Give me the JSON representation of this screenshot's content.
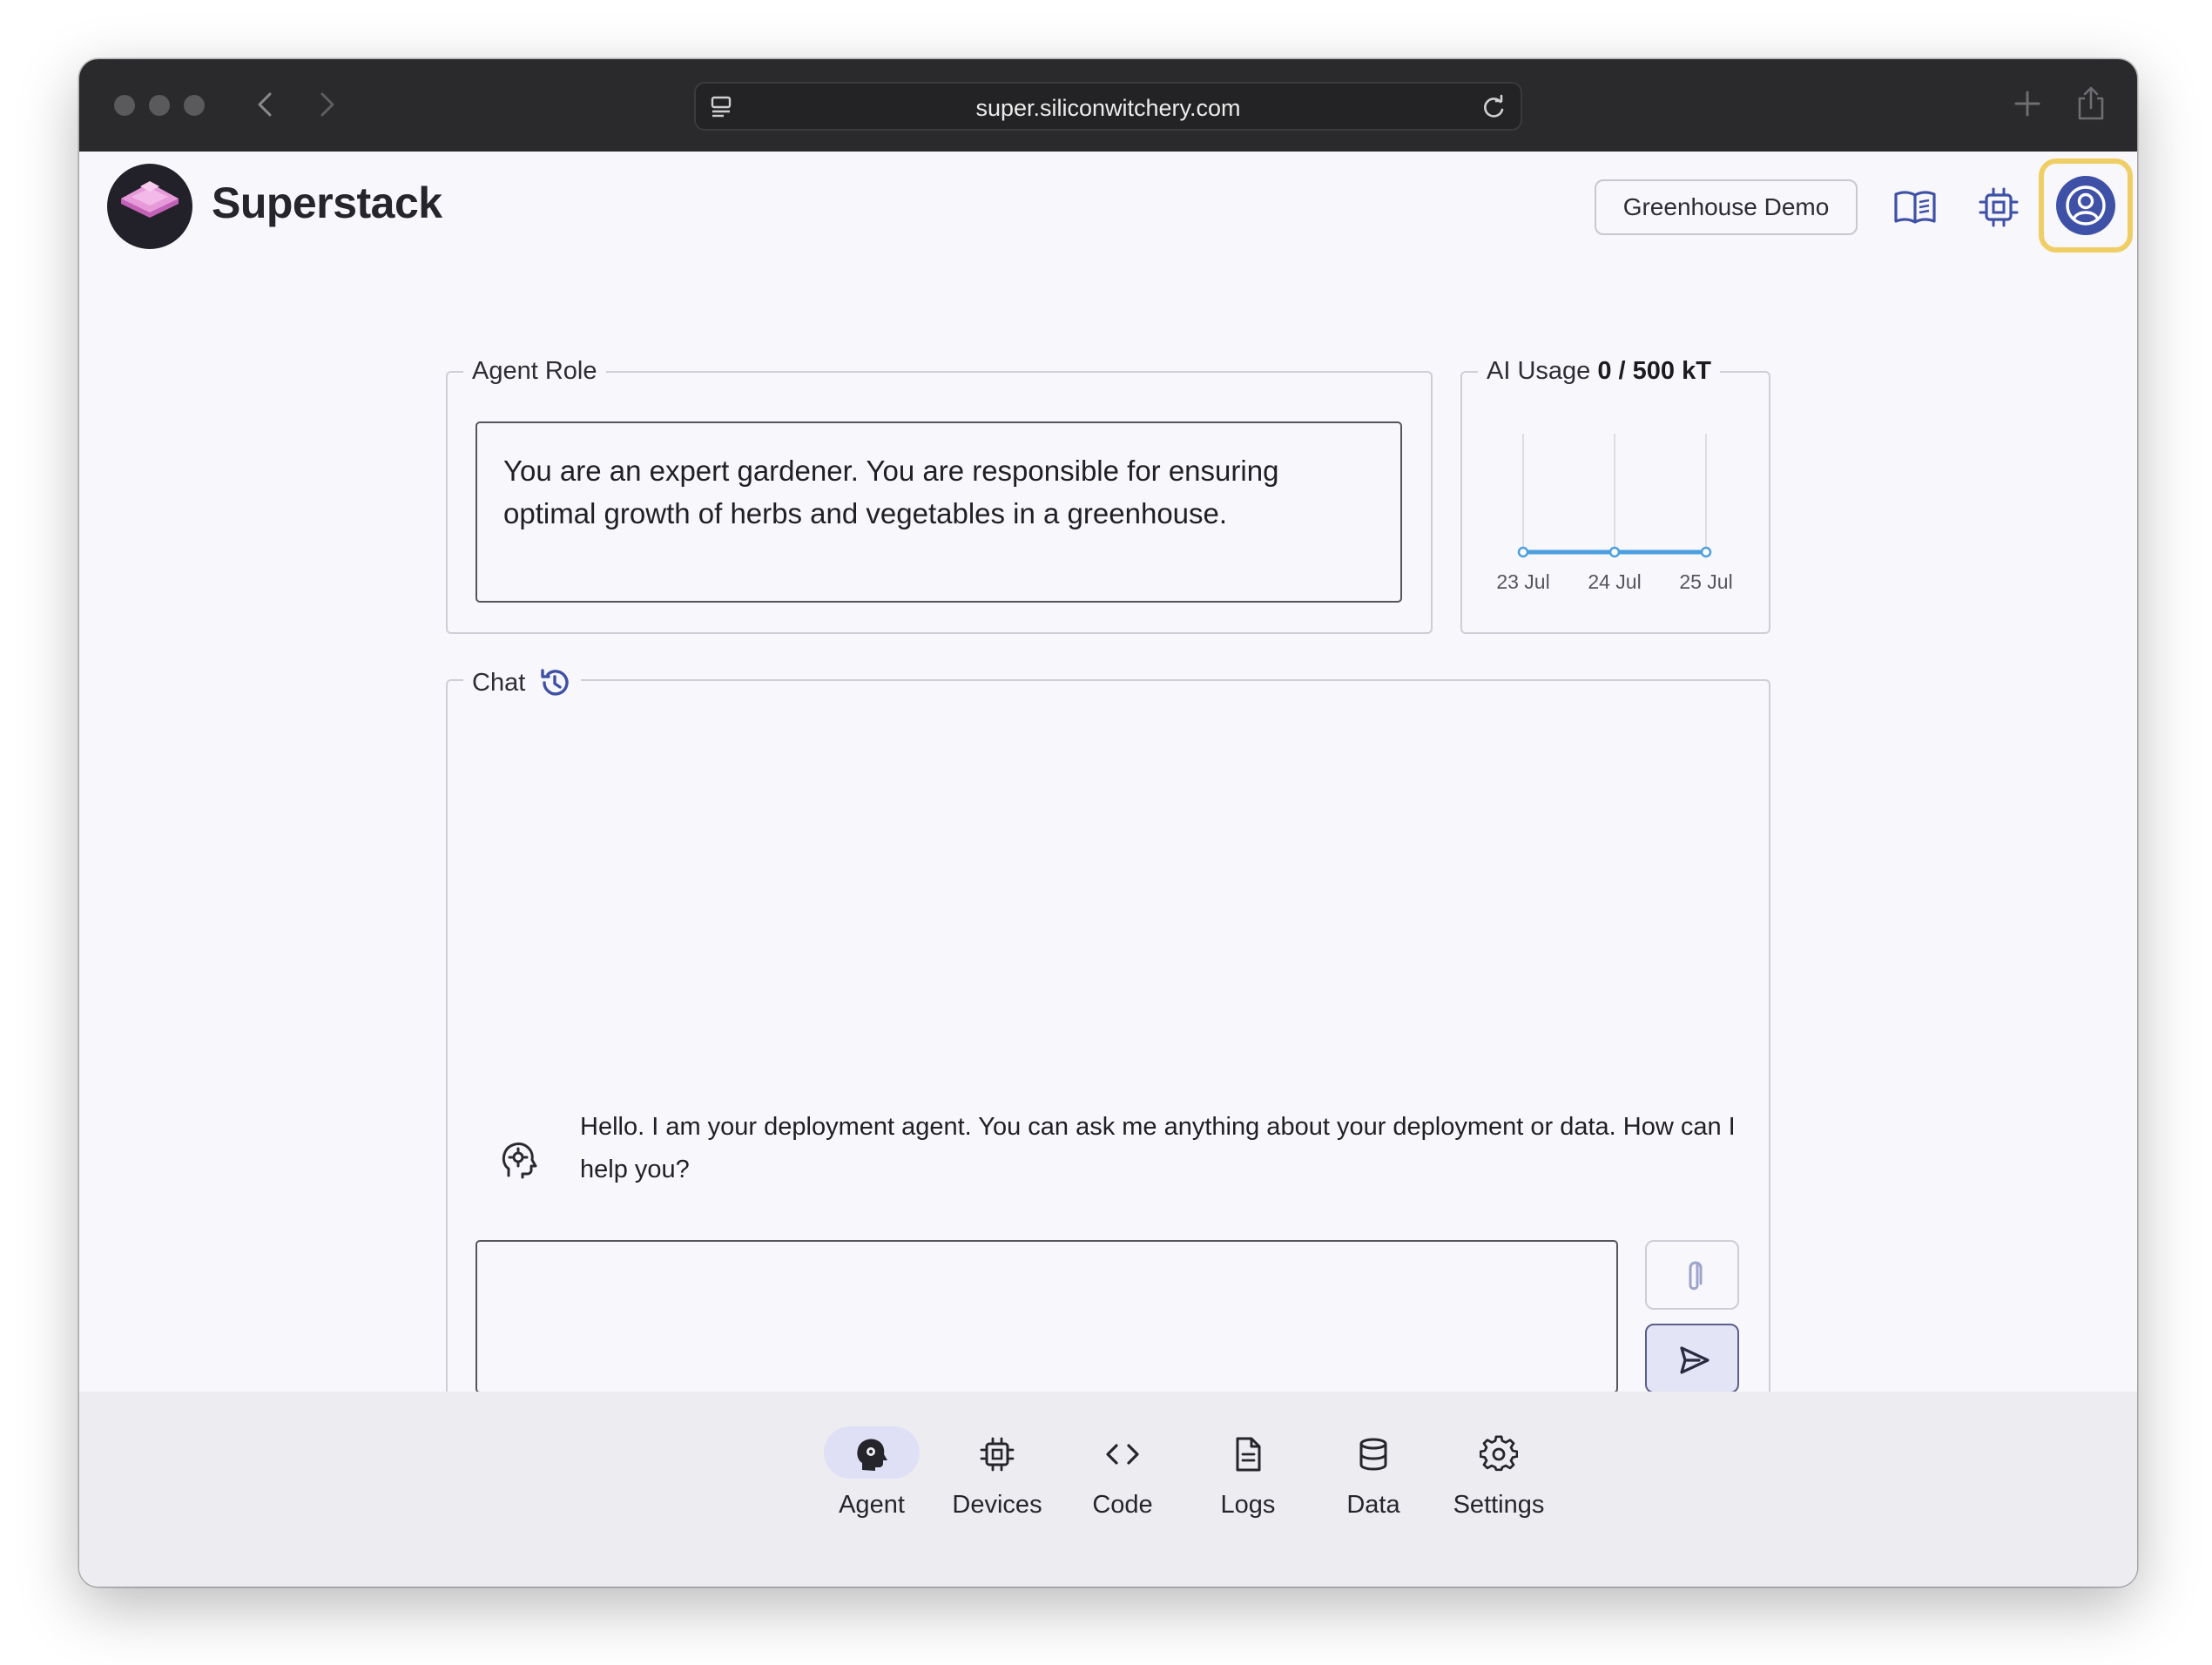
{
  "browser": {
    "url": "super.siliconwitchery.com"
  },
  "header": {
    "brand": "Superstack",
    "project_button": "Greenhouse Demo",
    "icons": [
      "docs-book-icon",
      "device-chip-icon",
      "account-circle-icon"
    ]
  },
  "agent_role": {
    "legend": "Agent Role",
    "text": "You are an expert gardener. You are responsible for ensuring optimal growth of herbs and vegetables in a greenhouse."
  },
  "ai_usage": {
    "legend_prefix": "AI Usage",
    "legend_value": "0 / 500 kT"
  },
  "chart_data": {
    "type": "line",
    "title": "AI Usage 0 / 500 kT",
    "categories": [
      "23 Jul",
      "24 Jul",
      "25 Jul"
    ],
    "series": [
      {
        "values": [
          0,
          0,
          0
        ]
      }
    ],
    "xlabel": "",
    "ylabel": "",
    "color": "#4b9ee0",
    "grid": "vertical"
  },
  "chat": {
    "legend": "Chat",
    "history_icon": "history-icon",
    "messages": [
      {
        "role": "agent",
        "text": "Hello. I am your deployment agent. You can ask me anything about your deployment or data. How can I help you?"
      }
    ],
    "input_value": "",
    "attach_icon": "paperclip-icon",
    "send_icon": "send-icon"
  },
  "bottom_nav": {
    "items": [
      {
        "label": "Agent",
        "icon": "agent-head-icon",
        "active": true
      },
      {
        "label": "Devices",
        "icon": "chip-icon",
        "active": false
      },
      {
        "label": "Code",
        "icon": "code-icon",
        "active": false
      },
      {
        "label": "Logs",
        "icon": "document-icon",
        "active": false
      },
      {
        "label": "Data",
        "icon": "database-icon",
        "active": false
      },
      {
        "label": "Settings",
        "icon": "gear-icon",
        "active": false
      }
    ]
  },
  "colors": {
    "accent": "#3f51a6",
    "highlight": "#f0ce66",
    "chart_line": "#4b9ee0",
    "active_nav": "#dfe0f6"
  }
}
